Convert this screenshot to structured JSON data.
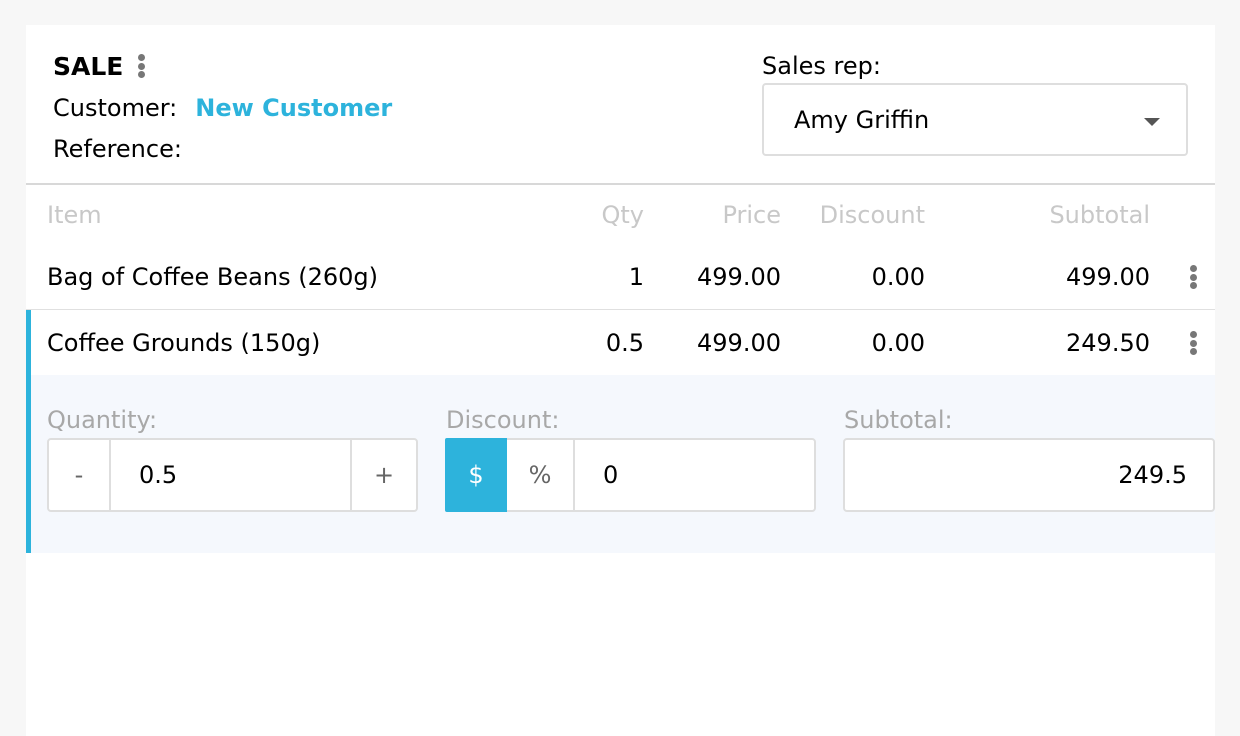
{
  "header": {
    "title": "SALE",
    "customer_label": "Customer:",
    "customer_value": "New Customer",
    "reference_label": "Reference:"
  },
  "sales_rep": {
    "label": "Sales rep:",
    "selected": "Amy Griffin"
  },
  "table": {
    "columns": [
      "Item",
      "Qty",
      "Price",
      "Discount",
      "Subtotal"
    ],
    "rows": [
      {
        "item": "Bag of Coffee Beans (260g)",
        "qty": "1",
        "price": "499.00",
        "discount": "0.00",
        "subtotal": "499.00"
      },
      {
        "item": "Coffee Grounds (150g)",
        "qty": "0.5",
        "price": "499.00",
        "discount": "0.00",
        "subtotal": "249.50"
      }
    ]
  },
  "editor": {
    "quantity_label": "Quantity:",
    "decrement": "-",
    "quantity_value": "0.5",
    "increment": "+",
    "discount_label": "Discount:",
    "dollar": "$",
    "percent": "%",
    "discount_value": "0",
    "subtotal_label": "Subtotal:",
    "subtotal_value": "249.5"
  },
  "colors": {
    "accent": "#2db3dc",
    "edit_background": "#f5f8fd"
  }
}
